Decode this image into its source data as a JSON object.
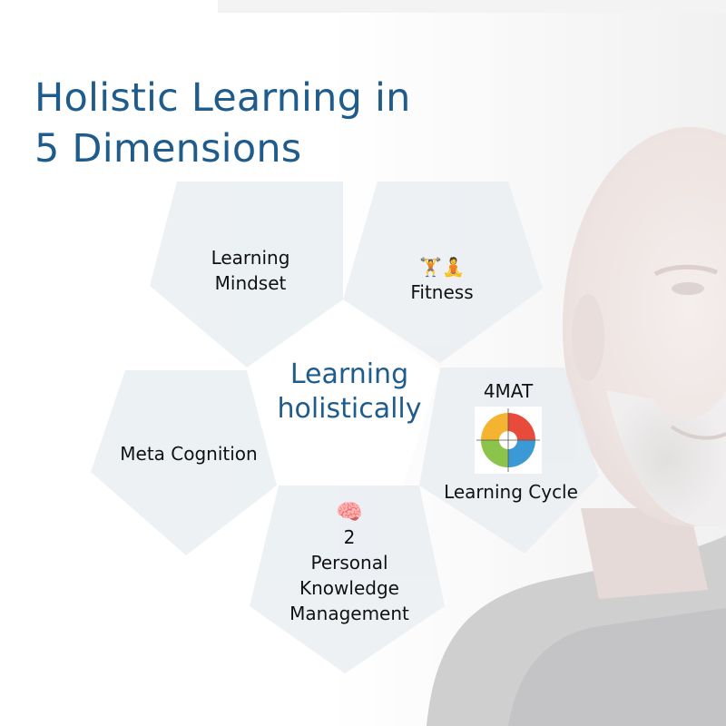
{
  "title": {
    "line1": "Holistic Learning in",
    "line2": "5 Dimensions"
  },
  "center": {
    "line1": "Learning",
    "line2": "holistically"
  },
  "dimensions": {
    "mindset": {
      "line1": "Learning",
      "line2": "Mindset"
    },
    "fitness": {
      "icons": "🏋🧘",
      "label": "Fitness"
    },
    "meta": {
      "label": "Meta Cognition"
    },
    "pkm": {
      "icon": "🧠",
      "number": "2",
      "line1": "Personal",
      "line2": "Knowledge",
      "line3": "Management"
    },
    "cycle": {
      "top": "4MAT",
      "bottom": "Learning Cycle"
    }
  },
  "colors": {
    "title": "#1f5c8c",
    "outer_pentagon": "#e9eef2",
    "center_pentagon": "#ffffff",
    "wheel": [
      "#e84a3c",
      "#f4b331",
      "#8cc34b",
      "#3b9ad6"
    ]
  }
}
